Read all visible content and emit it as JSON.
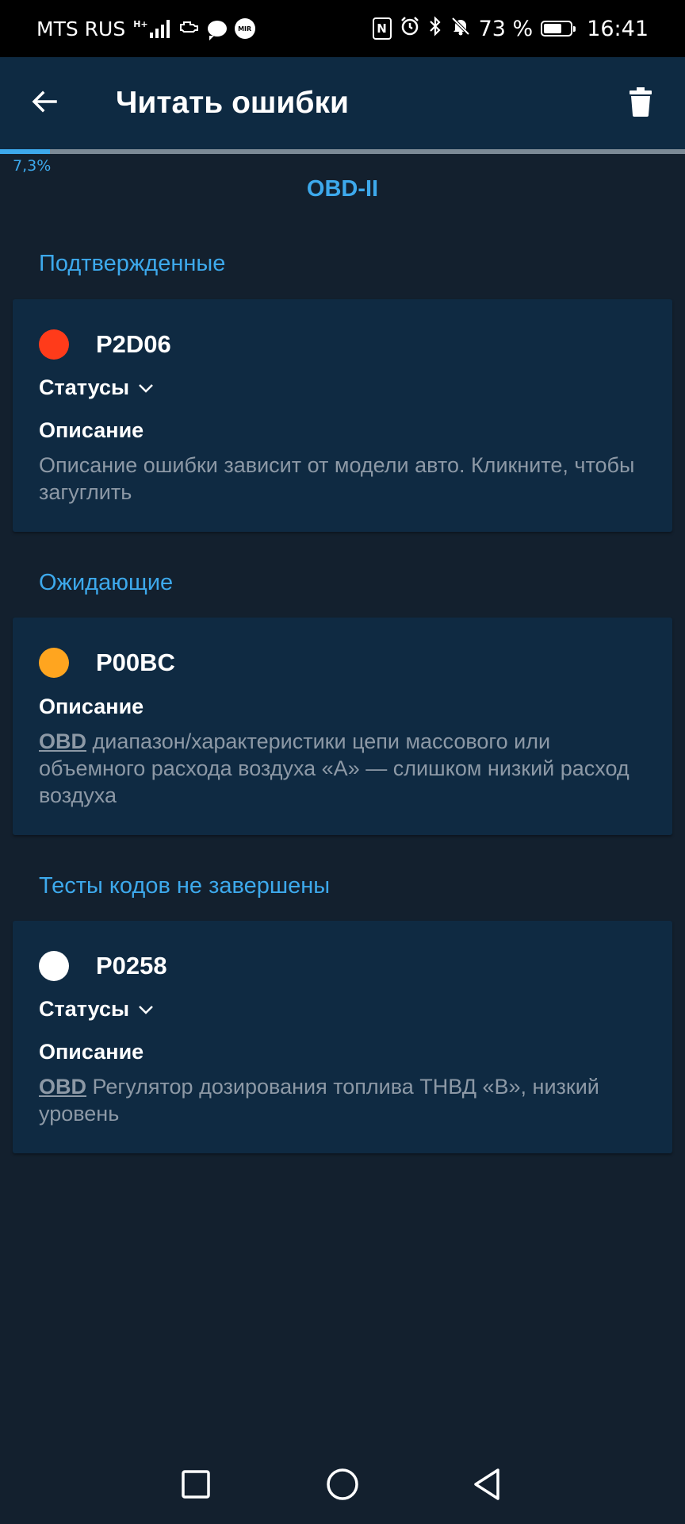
{
  "status_bar": {
    "carrier": "MTS RUS",
    "network_type": "H+",
    "battery_percent_text": "73 %",
    "battery_level": 0.73,
    "time": "16:41",
    "mir_badge": "MIR",
    "nfc_label": "N",
    "icons": [
      "signal-icon",
      "car-engine-icon",
      "chat-icon",
      "mir-pay-icon",
      "nfc-icon",
      "alarm-icon",
      "bluetooth-icon",
      "mute-bell-icon",
      "battery-icon"
    ]
  },
  "app_bar": {
    "title": "Читать ошибки",
    "back_icon": "arrow-left-icon",
    "delete_icon": "trash-icon"
  },
  "progress": {
    "value": 0.073,
    "label": "7,3%"
  },
  "protocol": "OBD-II",
  "colors": {
    "accent": "#3da9ec",
    "confirmed_dot": "#ff3b1a",
    "pending_dot": "#ffa51f",
    "incomplete_dot": "#ffffff"
  },
  "sections": [
    {
      "heading": "Подтвержденные",
      "card": {
        "code": "P2D06",
        "dot_color": "#ff3b1a",
        "statuses_label": "Статусы",
        "description_title": "Описание",
        "description_link": "",
        "description_text": "Описание ошибки зависит от модели авто. Кликните, чтобы загуглить"
      }
    },
    {
      "heading": "Ожидающие",
      "card": {
        "code": "P00BC",
        "dot_color": "#ffa51f",
        "description_title": "Описание",
        "description_link": "OBD",
        "description_text": " диапазон/характеристики цепи массового или объемного расхода воздуха «А» — слишком низкий расход воздуха"
      }
    },
    {
      "heading": "Тесты кодов не завершены",
      "card": {
        "code": "P0258",
        "dot_color": "#ffffff",
        "statuses_label": "Статусы",
        "description_title": "Описание",
        "description_link": "OBD",
        "description_text": " Регулятор дозирования топлива ТНВД «В», низкий уровень"
      }
    }
  ],
  "nav_bar": {
    "icons": [
      "recents-square-icon",
      "home-circle-icon",
      "back-triangle-icon"
    ]
  }
}
